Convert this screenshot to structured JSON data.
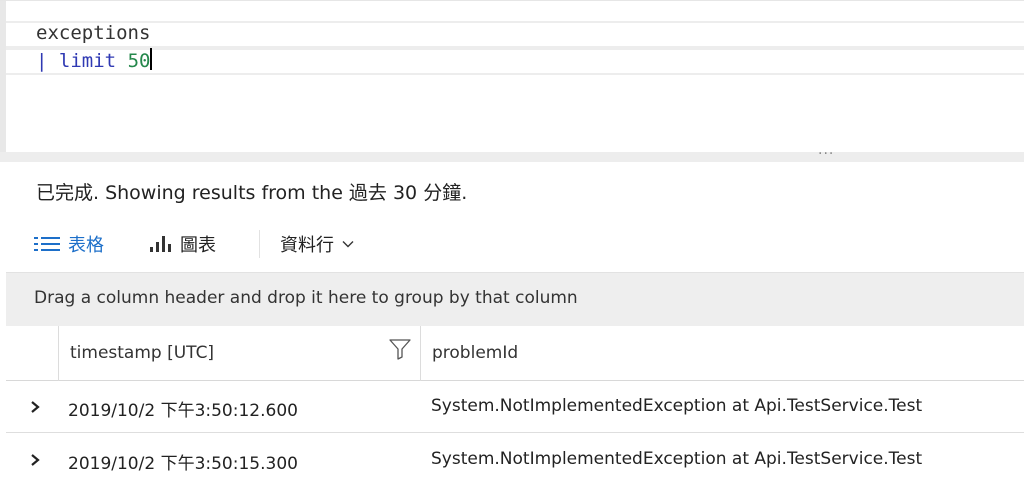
{
  "editor": {
    "line1": {
      "table": "exceptions"
    },
    "line2": {
      "pipe": "|",
      "op": "limit",
      "num": "50"
    }
  },
  "splitter": {
    "handle": "..."
  },
  "status": {
    "text": "已完成. Showing results from the 過去 30 分鐘."
  },
  "toolbar": {
    "table_label": "表格",
    "chart_label": "圖表",
    "columns_label": "資料行",
    "accent": "#1d6fc9"
  },
  "groupbar": {
    "text": "Drag a column header and drop it here to group by that column"
  },
  "grid": {
    "columns": [
      "timestamp [UTC]",
      "problemId"
    ],
    "rows": [
      {
        "timestamp": "2019/10/2 下午3:50:12.600",
        "problemId": "System.NotImplementedException at Api.TestService.Test"
      },
      {
        "timestamp": "2019/10/2 下午3:50:15.300",
        "problemId": "System.NotImplementedException at Api.TestService.Test"
      }
    ]
  },
  "icons": {
    "table": "list-icon",
    "chart": "bar-chart-icon",
    "columns_dropdown": "chevron-down-icon",
    "filter": "filter-icon",
    "expand": "chevron-right-icon"
  }
}
